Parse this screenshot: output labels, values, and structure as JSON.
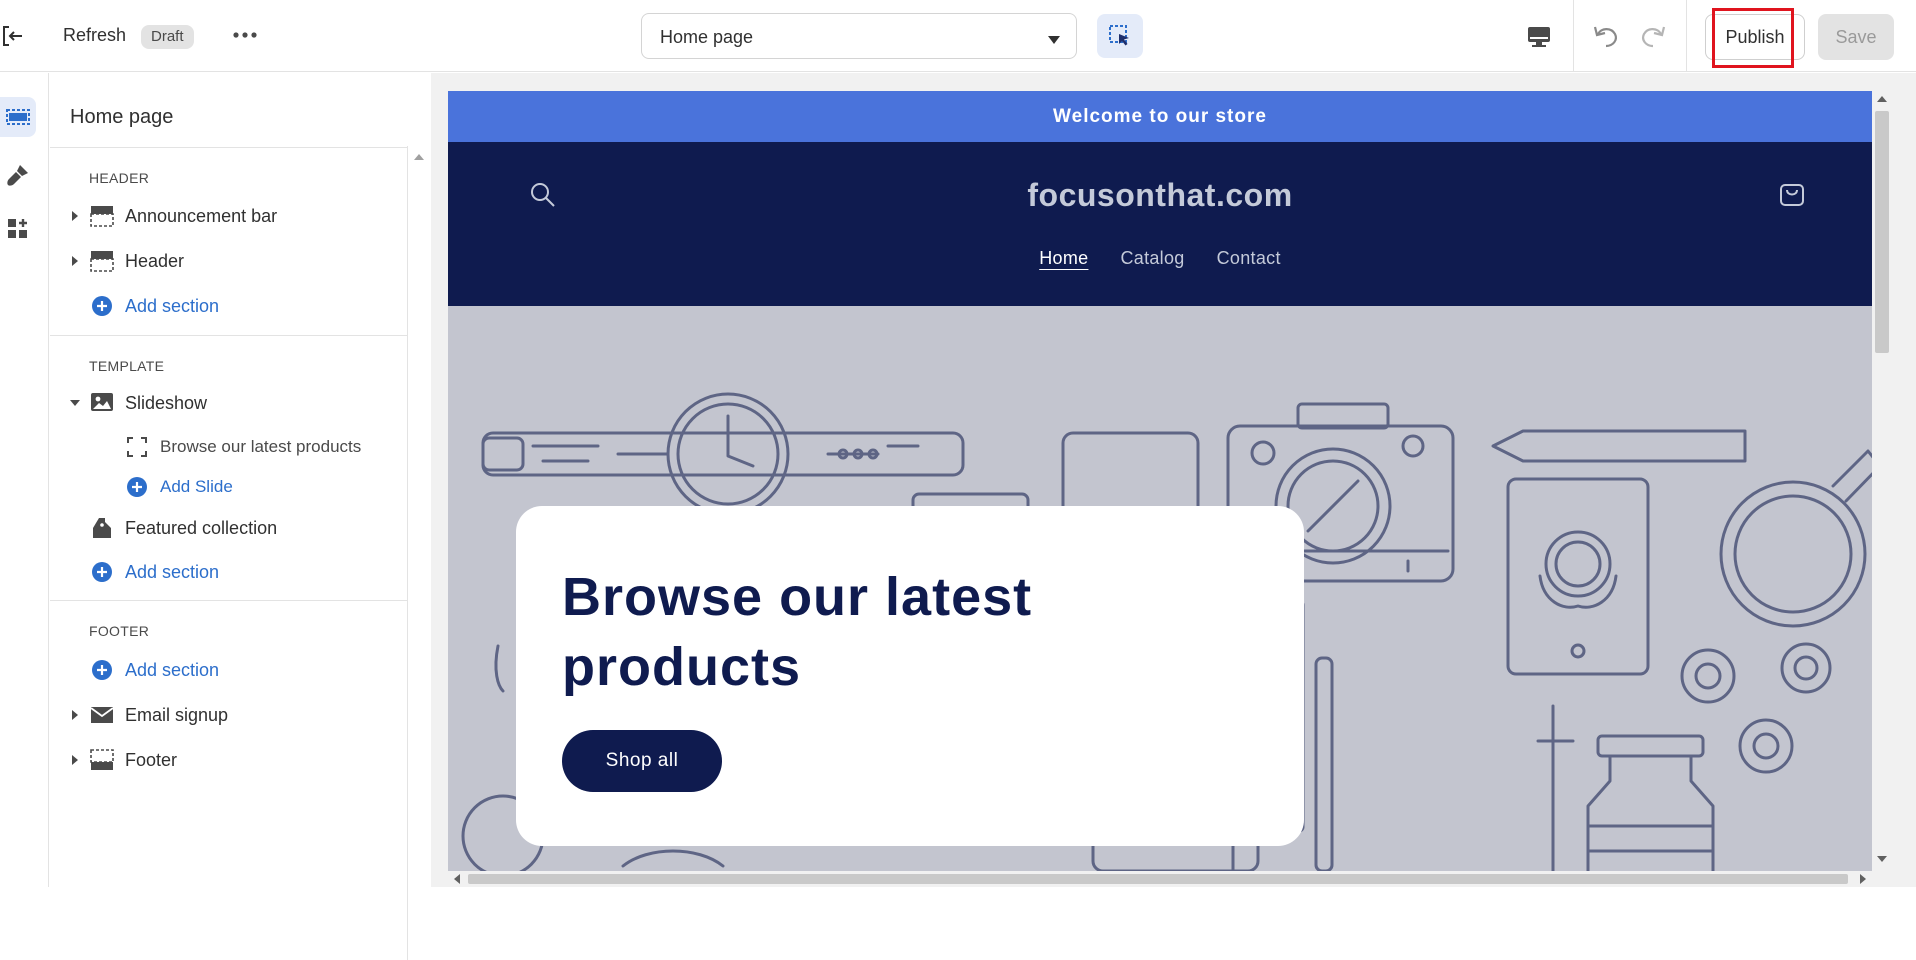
{
  "topbar": {
    "exit_icon": "exit-icon",
    "refresh_label": "Refresh",
    "status_badge": "Draft",
    "more_icon": "more-horizontal-icon",
    "page_selector_value": "Home page",
    "inspector_icon": "select-element-icon",
    "device_icon": "desktop-icon",
    "undo_icon": "undo-icon",
    "redo_icon": "redo-icon",
    "publish_label": "Publish",
    "save_label": "Save"
  },
  "rail": {
    "items": [
      {
        "icon": "sections-icon",
        "active": true
      },
      {
        "icon": "theme-settings-icon",
        "active": false
      },
      {
        "icon": "apps-icon",
        "active": false
      }
    ]
  },
  "panel": {
    "title": "Home page",
    "header_group": {
      "label": "HEADER",
      "items": [
        {
          "label": "Announcement bar",
          "icon": "layout-header-icon"
        },
        {
          "label": "Header",
          "icon": "layout-header-icon"
        }
      ],
      "add_label": "Add section"
    },
    "template_group": {
      "label": "TEMPLATE",
      "slideshow_label": "Slideshow",
      "slide_label": "Browse our latest products",
      "add_slide_label": "Add Slide",
      "featured_label": "Featured collection",
      "add_label": "Add section"
    },
    "footer_group": {
      "label": "FOOTER",
      "add_label": "Add section",
      "items": [
        {
          "label": "Email signup",
          "icon": "email-icon"
        },
        {
          "label": "Footer",
          "icon": "layout-footer-icon"
        }
      ]
    }
  },
  "preview": {
    "announcement": "Welcome to our store",
    "store_name": "focusonthat.com",
    "nav": [
      "Home",
      "Catalog",
      "Contact"
    ],
    "active_nav": "Home",
    "hero_title": "Browse our latest products",
    "hero_button": "Shop all"
  },
  "colors": {
    "accent": "#2c6ecb",
    "announcement_bg": "#4a73db",
    "header_bg": "#0f1b4f",
    "hero_bg": "#c3c5cf",
    "highlight": "#e0141e"
  }
}
